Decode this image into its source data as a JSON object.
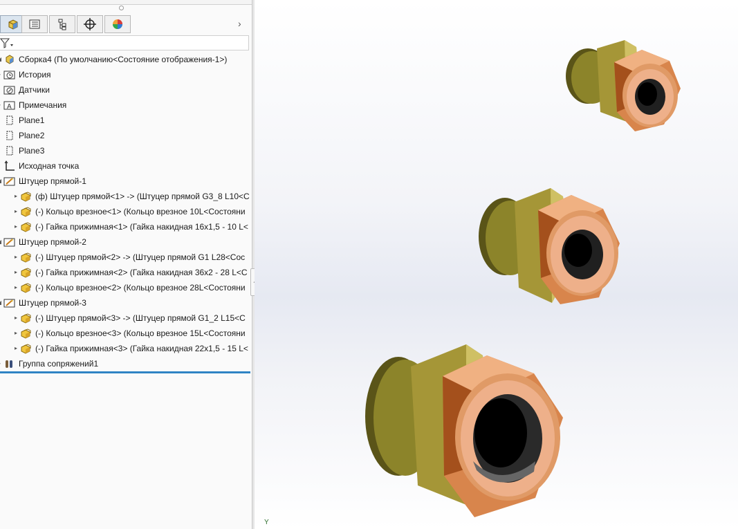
{
  "feature_tree": {
    "root": "Сборка4  (По умолчанию<Состояние отображения-1>)",
    "items": [
      {
        "label": "История"
      },
      {
        "label": "Датчики"
      },
      {
        "label": "Примечания"
      },
      {
        "label": "Plane1"
      },
      {
        "label": "Plane2"
      },
      {
        "label": "Plane3"
      },
      {
        "label": "Исходная точка"
      },
      {
        "label": "Штуцер прямой-1"
      },
      {
        "label": "(ф) Штуцер прямой<1> -> (Штуцер прямой G3_8 L10<С"
      },
      {
        "label": "(-) Кольцо врезное<1> (Кольцо врезное 10L<Состояни"
      },
      {
        "label": "(-) Гайка прижимная<1> (Гайка накидная 16x1,5 - 10 L<"
      },
      {
        "label": "Штуцер прямой-2"
      },
      {
        "label": "(-) Штуцер прямой<2> -> (Штуцер прямой G1 L28<Сос"
      },
      {
        "label": "(-) Гайка прижимная<2> (Гайка накидная 36x2 - 28 L<С"
      },
      {
        "label": "(-) Кольцо врезное<2> (Кольцо врезное 28L<Состояни"
      },
      {
        "label": "Штуцер прямой-3"
      },
      {
        "label": "(-) Штуцер прямой<3> -> (Штуцер прямой G1_2 L15<С"
      },
      {
        "label": "(-) Кольцо врезное<3> (Кольцо врезное 15L<Состояни"
      },
      {
        "label": "(-) Гайка прижимная<3> (Гайка накидная 22x1,5 - 15 L<"
      },
      {
        "label": "Группа сопряжений1"
      }
    ]
  },
  "tabs": [
    {
      "icon": "feature-manager-icon"
    },
    {
      "icon": "property-manager-icon"
    },
    {
      "icon": "configuration-manager-icon"
    },
    {
      "icon": "dimxpert-icon"
    },
    {
      "icon": "display-manager-icon"
    }
  ],
  "viewport": {
    "triad_label": "Y"
  },
  "colors": {
    "selection_line": "#2f84c4",
    "copper": "#c9743f",
    "brass": "#b7a53a"
  }
}
